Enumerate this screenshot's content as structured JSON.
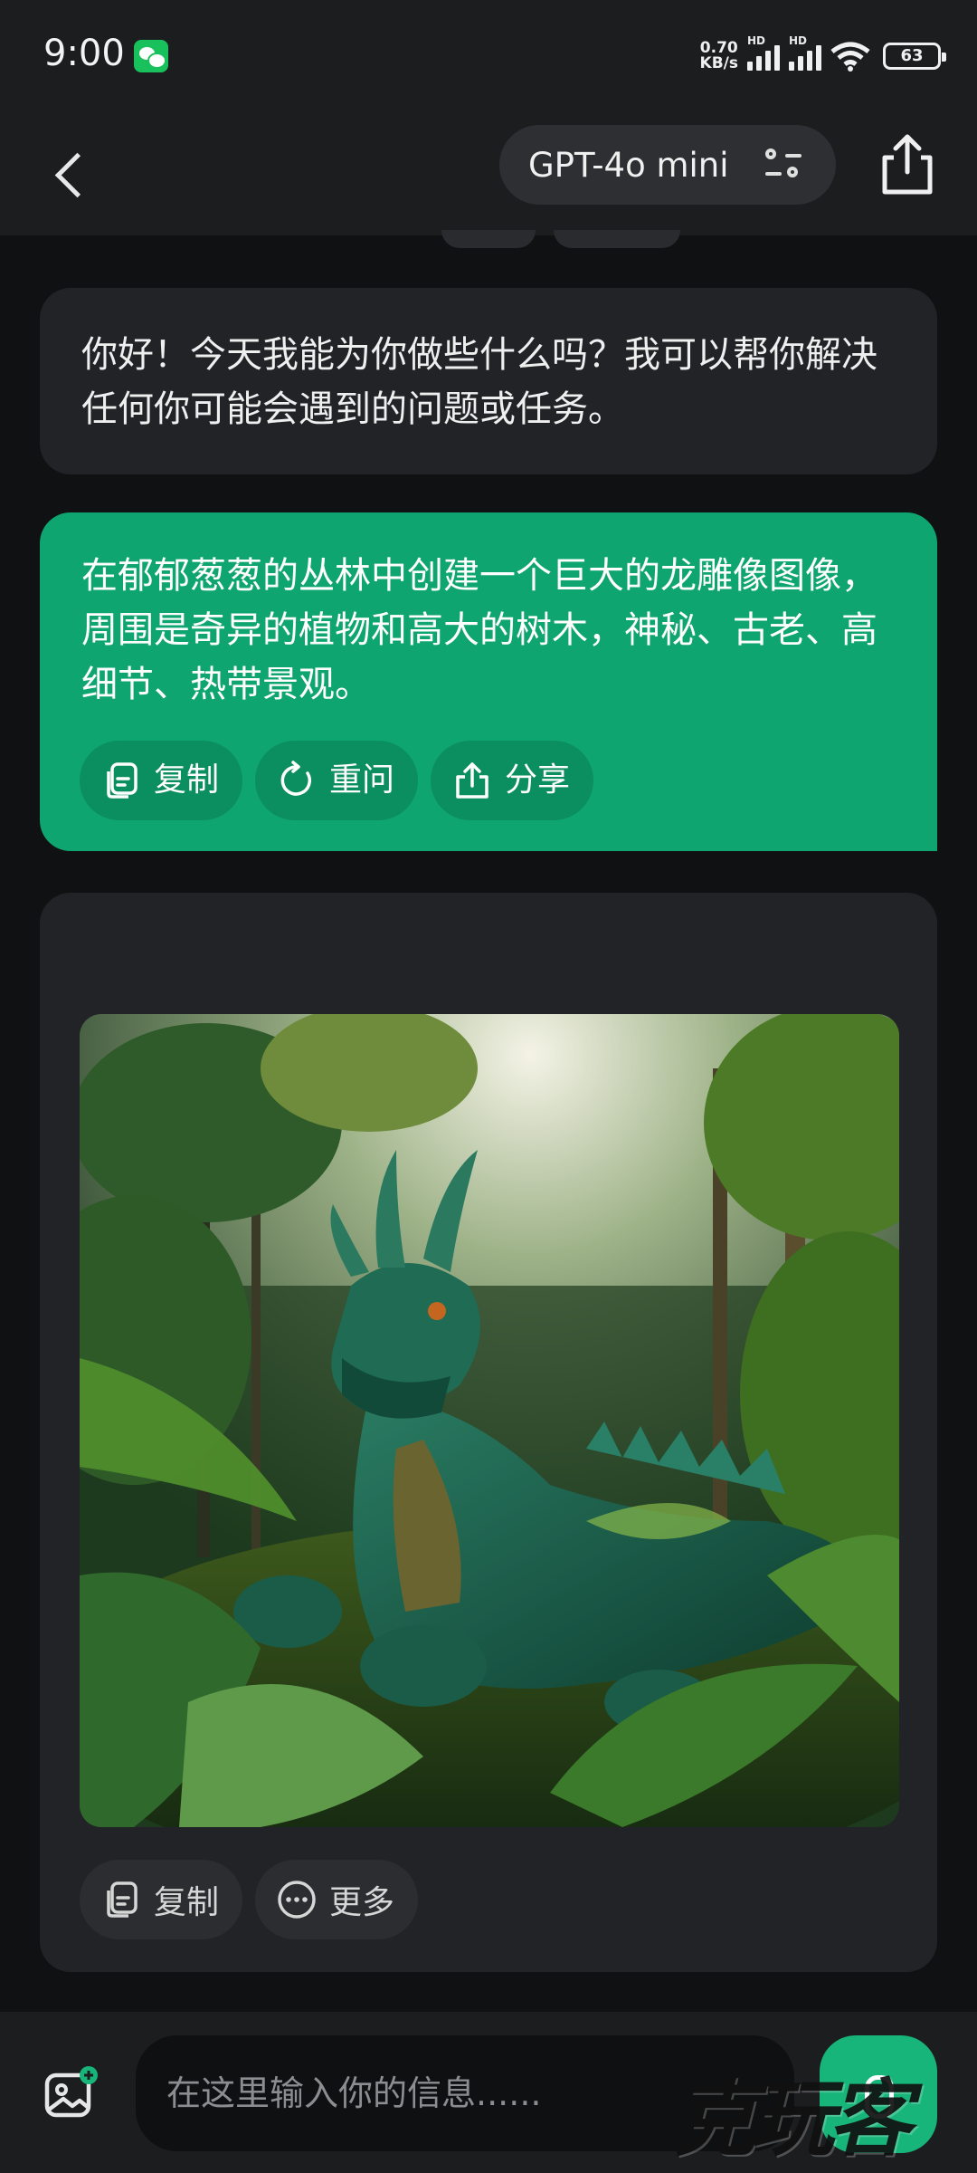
{
  "status_bar": {
    "time": "9:00",
    "net_speed_value": "0.70",
    "net_speed_unit": "KB/s",
    "signal_label": "HD",
    "battery": "63"
  },
  "header": {
    "model_name": "GPT-4o mini"
  },
  "messages": {
    "assistant_greeting": "你好！今天我能为你做些什么吗？我可以帮你解决任何你可能会遇到的问题或任务。",
    "user_prompt": "在郁郁葱葱的丛林中创建一个巨大的龙雕像图像，周围是奇异的植物和高大的树木，神秘、古老、高细节、热带景观。",
    "user_actions": {
      "copy": "复制",
      "retry": "重问",
      "share": "分享"
    },
    "image_actions": {
      "copy": "复制",
      "more": "更多"
    }
  },
  "input": {
    "placeholder": "在这里输入你的信息......"
  },
  "watermark": "克玩客",
  "colors": {
    "accent_green": "#0ea570",
    "bubble_dark": "#222326",
    "background": "#101112"
  }
}
